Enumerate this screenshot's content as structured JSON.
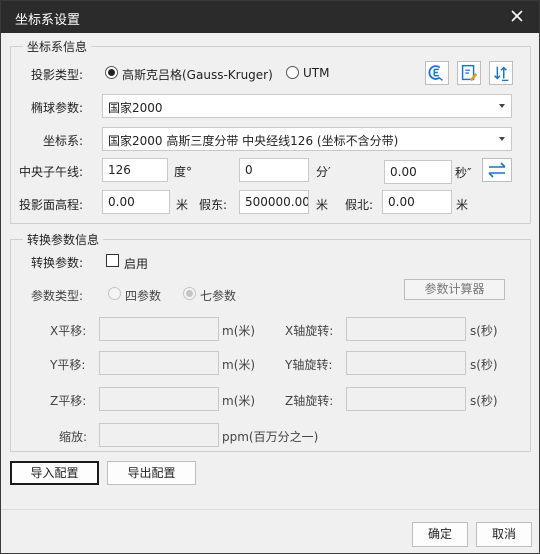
{
  "window": {
    "title": "坐标系设置"
  },
  "coord_info": {
    "group_title": "坐标系信息",
    "projection_type_label": "投影类型:",
    "proj_options": [
      "高斯克吕格(Gauss-Kruger)",
      "UTM"
    ],
    "proj_selected": "高斯克吕格(Gauss-Kruger)",
    "ellipsoid_label": "椭球参数:",
    "ellipsoid_value": "国家2000",
    "coordsys_label": "坐标系:",
    "coordsys_value": "国家2000 高斯三度分带 中央经线126 (坐标不含分带)",
    "central_meridian_label": "中央子午线:",
    "deg_value": "126",
    "deg_unit": "度°",
    "min_value": "0",
    "min_unit": "分′",
    "sec_value": "0.00",
    "sec_unit": "秒″",
    "proj_height_label": "投影面高程:",
    "proj_height_value": "0.00",
    "meter_unit": "米",
    "false_east_label": "假东:",
    "false_east_value": "500000.00",
    "false_north_label": "假北:",
    "false_north_value": "0.00"
  },
  "transform": {
    "group_title": "转换参数信息",
    "transform_label": "转换参数:",
    "enable_label": "启用",
    "enabled": false,
    "param_type_label": "参数类型:",
    "param_options": [
      "四参数",
      "七参数"
    ],
    "param_selected": "七参数",
    "calculator_label": "参数计算器",
    "x_shift_label": "X平移:",
    "y_shift_label": "Y平移:",
    "z_shift_label": "Z平移:",
    "shift_unit": "m(米)",
    "x_rot_label": "X轴旋转:",
    "y_rot_label": "Y轴旋转:",
    "z_rot_label": "Z轴旋转:",
    "rot_unit": "s(秒)",
    "scale_label": "缩放:",
    "scale_unit": "ppm(百万分之一)"
  },
  "footer": {
    "import_label": "导入配置",
    "export_label": "导出配置",
    "ok_label": "确定",
    "cancel_label": "取消"
  },
  "icons": [
    "close-icon",
    "coord-lookup-icon",
    "coord-edit-icon",
    "coord-sort-icon",
    "swap-arrows-icon"
  ],
  "colors": {
    "titlebar": "#2b2b2b",
    "accent": "#1e73c8",
    "background": "#f0f0f0"
  }
}
